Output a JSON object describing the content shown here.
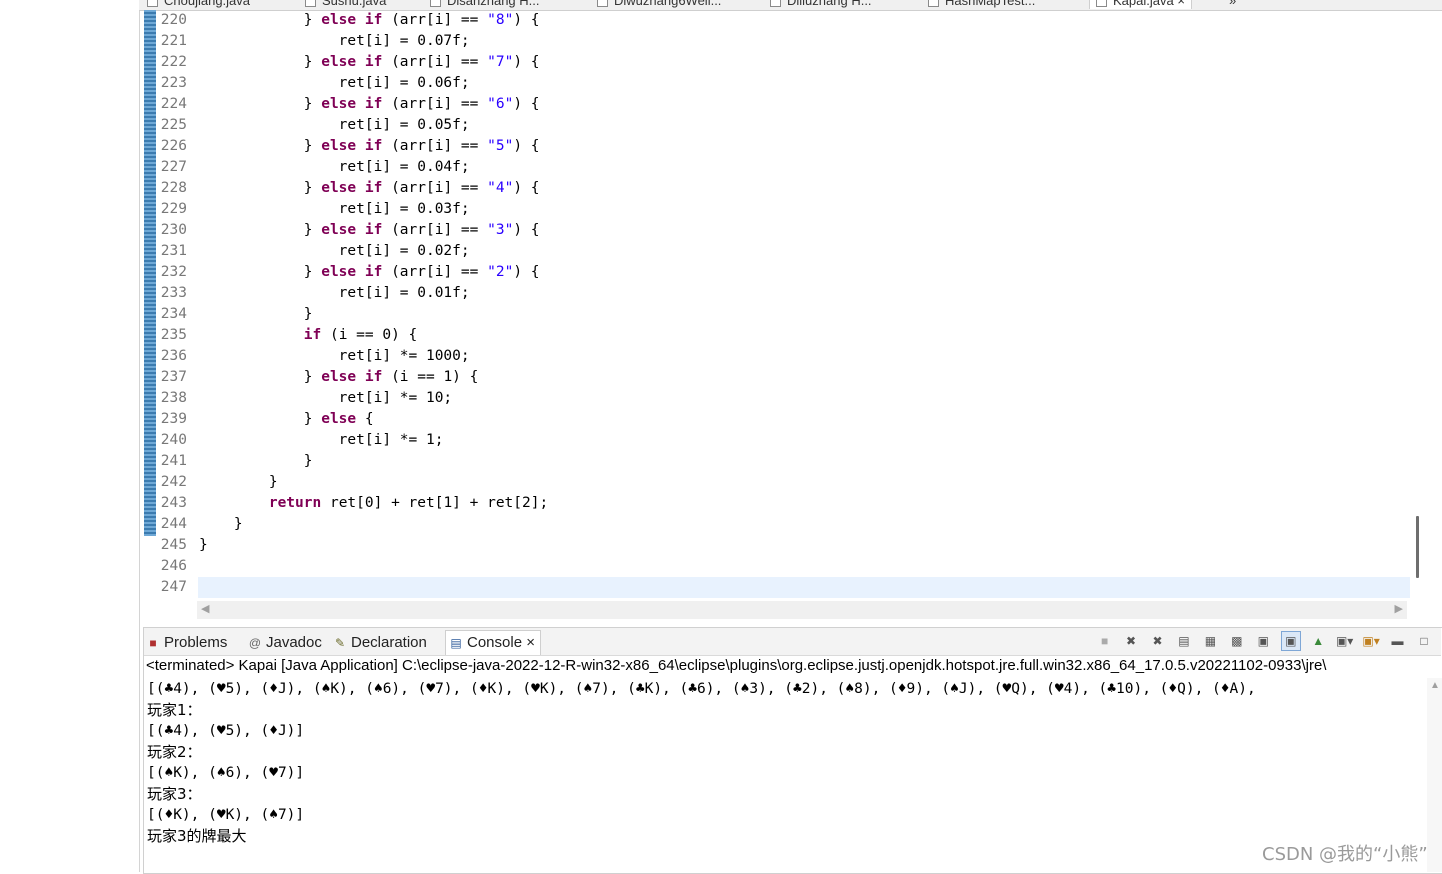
{
  "editor_tabs": [
    {
      "label": "Choujiang.java"
    },
    {
      "label": "Sushu.java"
    },
    {
      "label": "Disanzhang H..."
    },
    {
      "label": "Diwuzhang6Well..."
    },
    {
      "label": "Diliuzhang H..."
    },
    {
      "label": "HashMapTest..."
    },
    {
      "label": "Kapai.java",
      "close": "×",
      "overflow": "»"
    }
  ],
  "code_lines": [
    {
      "num": "220",
      "parts": [
        {
          "t": "            } "
        },
        {
          "t": "else",
          "k": "kw"
        },
        {
          "t": " "
        },
        {
          "t": "if",
          "k": "kw"
        },
        {
          "t": " (arr[i] == "
        },
        {
          "t": "\"8\"",
          "k": "str"
        },
        {
          "t": ") {"
        }
      ]
    },
    {
      "num": "221",
      "parts": [
        {
          "t": "                ret[i] = 0.07f;"
        }
      ]
    },
    {
      "num": "222",
      "parts": [
        {
          "t": "            } "
        },
        {
          "t": "else",
          "k": "kw"
        },
        {
          "t": " "
        },
        {
          "t": "if",
          "k": "kw"
        },
        {
          "t": " (arr[i] == "
        },
        {
          "t": "\"7\"",
          "k": "str"
        },
        {
          "t": ") {"
        }
      ]
    },
    {
      "num": "223",
      "parts": [
        {
          "t": "                ret[i] = 0.06f;"
        }
      ]
    },
    {
      "num": "224",
      "parts": [
        {
          "t": "            } "
        },
        {
          "t": "else",
          "k": "kw"
        },
        {
          "t": " "
        },
        {
          "t": "if",
          "k": "kw"
        },
        {
          "t": " (arr[i] == "
        },
        {
          "t": "\"6\"",
          "k": "str"
        },
        {
          "t": ") {"
        }
      ]
    },
    {
      "num": "225",
      "parts": [
        {
          "t": "                ret[i] = 0.05f;"
        }
      ]
    },
    {
      "num": "226",
      "parts": [
        {
          "t": "            } "
        },
        {
          "t": "else",
          "k": "kw"
        },
        {
          "t": " "
        },
        {
          "t": "if",
          "k": "kw"
        },
        {
          "t": " (arr[i] == "
        },
        {
          "t": "\"5\"",
          "k": "str"
        },
        {
          "t": ") {"
        }
      ]
    },
    {
      "num": "227",
      "parts": [
        {
          "t": "                ret[i] = 0.04f;"
        }
      ]
    },
    {
      "num": "228",
      "parts": [
        {
          "t": "            } "
        },
        {
          "t": "else",
          "k": "kw"
        },
        {
          "t": " "
        },
        {
          "t": "if",
          "k": "kw"
        },
        {
          "t": " (arr[i] == "
        },
        {
          "t": "\"4\"",
          "k": "str"
        },
        {
          "t": ") {"
        }
      ]
    },
    {
      "num": "229",
      "parts": [
        {
          "t": "                ret[i] = 0.03f;"
        }
      ]
    },
    {
      "num": "230",
      "parts": [
        {
          "t": "            } "
        },
        {
          "t": "else",
          "k": "kw"
        },
        {
          "t": " "
        },
        {
          "t": "if",
          "k": "kw"
        },
        {
          "t": " (arr[i] == "
        },
        {
          "t": "\"3\"",
          "k": "str"
        },
        {
          "t": ") {"
        }
      ]
    },
    {
      "num": "231",
      "parts": [
        {
          "t": "                ret[i] = 0.02f;"
        }
      ]
    },
    {
      "num": "232",
      "parts": [
        {
          "t": "            } "
        },
        {
          "t": "else",
          "k": "kw"
        },
        {
          "t": " "
        },
        {
          "t": "if",
          "k": "kw"
        },
        {
          "t": " (arr[i] == "
        },
        {
          "t": "\"2\"",
          "k": "str"
        },
        {
          "t": ") {"
        }
      ]
    },
    {
      "num": "233",
      "parts": [
        {
          "t": "                ret[i] = 0.01f;"
        }
      ]
    },
    {
      "num": "234",
      "parts": [
        {
          "t": "            }"
        }
      ]
    },
    {
      "num": "235",
      "parts": [
        {
          "t": "            "
        },
        {
          "t": "if",
          "k": "kw"
        },
        {
          "t": " (i == 0) {"
        }
      ]
    },
    {
      "num": "236",
      "parts": [
        {
          "t": "                ret[i] *= 1000;"
        }
      ]
    },
    {
      "num": "237",
      "parts": [
        {
          "t": "            } "
        },
        {
          "t": "else",
          "k": "kw"
        },
        {
          "t": " "
        },
        {
          "t": "if",
          "k": "kw"
        },
        {
          "t": " (i == 1) {"
        }
      ]
    },
    {
      "num": "238",
      "parts": [
        {
          "t": "                ret[i] *= 10;"
        }
      ]
    },
    {
      "num": "239",
      "parts": [
        {
          "t": "            } "
        },
        {
          "t": "else",
          "k": "kw"
        },
        {
          "t": " {"
        }
      ]
    },
    {
      "num": "240",
      "parts": [
        {
          "t": "                ret[i] *= 1;"
        }
      ]
    },
    {
      "num": "241",
      "parts": [
        {
          "t": "            }"
        }
      ]
    },
    {
      "num": "242",
      "parts": [
        {
          "t": "        }"
        }
      ]
    },
    {
      "num": "243",
      "parts": [
        {
          "t": "        "
        },
        {
          "t": "return",
          "k": "kw"
        },
        {
          "t": " ret[0] + ret[1] + ret[2];"
        }
      ]
    },
    {
      "num": "244",
      "parts": [
        {
          "t": "    }"
        }
      ]
    },
    {
      "num": "245",
      "parts": [
        {
          "t": "}"
        }
      ]
    },
    {
      "num": "246",
      "parts": []
    },
    {
      "num": "247",
      "parts": [],
      "current": true
    }
  ],
  "view_tabs": {
    "problems": "Problems",
    "javadoc": "Javadoc",
    "declaration": "Declaration",
    "console": "Console",
    "console_close": "×"
  },
  "console": {
    "terminated": "<terminated> Kapai [Java Application] C:\\eclipse-java-2022-12-R-win32-x86_64\\eclipse\\plugins\\org.eclipse.justj.openjdk.hotspot.jre.full.win32.x86_64_17.0.5.v20221102-0933\\jre\\",
    "lines": [
      {
        "text": "[(♣4), (♥5), (♦J), (♠K), (♠6), (♥7), (♦K), (♥K), (♠7), (♣K), (♣6), (♠3), (♣2), (♠8), (♦9), (♠J), (♥Q), (♥4), (♣10), (♦Q), (♦A),"
      },
      {
        "text": "玩家1：",
        "cn": true
      },
      {
        "text": "[(♣4), (♥5), (♦J)]"
      },
      {
        "text": "玩家2：",
        "cn": true
      },
      {
        "text": "[(♠K), (♠6), (♥7)]"
      },
      {
        "text": "玩家3：",
        "cn": true
      },
      {
        "text": "[(♦K), (♥K), (♠7)]"
      },
      {
        "text": "玩家3的牌最大",
        "cn": true
      }
    ]
  },
  "watermark": "CSDN @我的“小熊”",
  "icons": {
    "problems": "problems-icon",
    "javadoc": "at-icon",
    "declaration": "declaration-icon",
    "console": "console-icon"
  }
}
